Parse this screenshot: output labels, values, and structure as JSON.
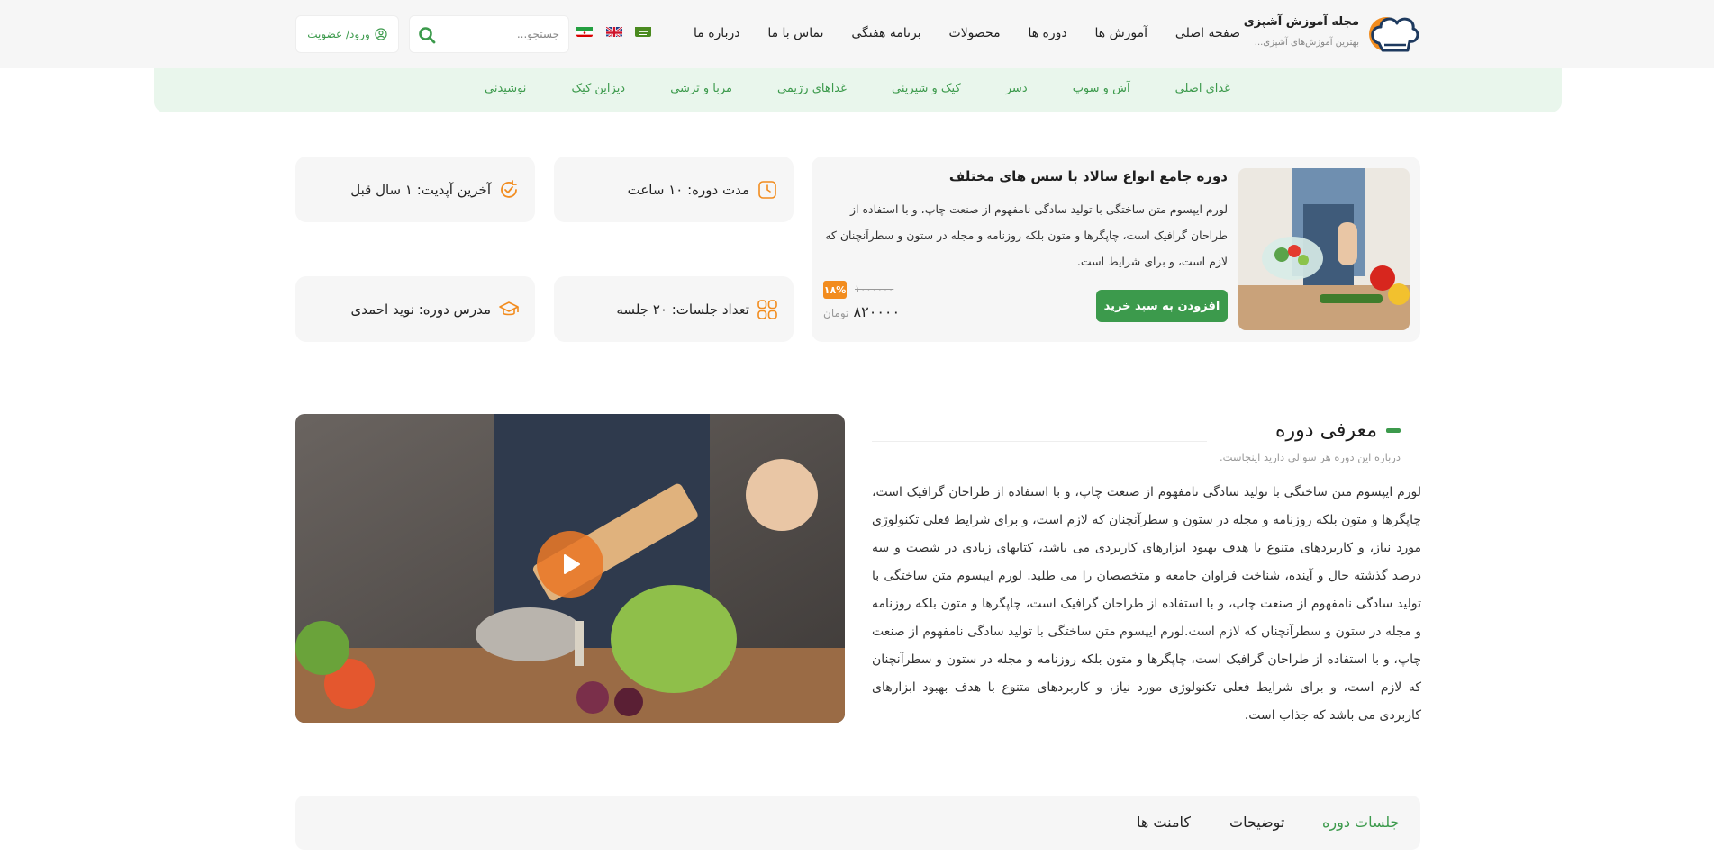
{
  "brand": {
    "title": "مجله آموزش آشپزی",
    "subtitle": "بهترین آموزش‌های آشپزی..."
  },
  "nav": [
    "صفحه اصلی",
    "آموزش ها",
    "دوره ها",
    "محصولات",
    "برنامه هفتگی",
    "تماس با ما",
    "درباره ما"
  ],
  "flags": [
    "iran-flag",
    "uk-flag",
    "saudi-flag"
  ],
  "search": {
    "placeholder": "جستجو..."
  },
  "login": {
    "label": "ورود/ عضویت"
  },
  "categories": [
    "غذای اصلی",
    "آش و سوپ",
    "دسر",
    "کیک و شیرینی",
    "غذاهای رژیمی",
    "مربا و ترشی",
    "دیزاین کیک",
    "نوشیدنی"
  ],
  "course": {
    "title": "دوره جامع انواع سالاد با سس های مختلف",
    "description": "لورم ایپسوم متن ساختگی با تولید سادگی نامفهوم از صنعت چاپ، و با استفاده از طراحان گرافیک است، چاپگرها و متون بلکه روزنامه و مجله در ستون و سطرآنچنان که لازم است، و برای شرایط است.",
    "cart_label": "افزودن به سبد خرید",
    "discount": "۱۸%",
    "old_price": "۱۰۰۰۰۰۰",
    "price": "۸۲۰۰۰۰",
    "currency": "تومان"
  },
  "info": {
    "duration": "مدت دوره: ۱۰ ساعت",
    "last_update": "آخرین آپدیت: ۱ سال قبل",
    "sessions": "تعداد جلسات: ۲۰ جلسه",
    "teacher": "مدرس دوره: نوید احمدی"
  },
  "intro": {
    "title": "معرفی دوره",
    "subtitle": "درباره این دوره هر سوالی دارید اینجاست.",
    "text": "لورم ایپسوم متن ساختگی با تولید سادگی نامفهوم از صنعت چاپ، و با استفاده از طراحان گرافیک است، چاپگرها و متون بلکه روزنامه و مجله در ستون و سطرآنچنان که لازم است، و برای شرایط فعلی تکنولوژی مورد نیاز، و کاربردهای متنوع با هدف بهبود ابزارهای کاربردی می باشد، کتابهای زیادی در شصت و سه درصد گذشته حال و آینده، شناخت فراوان جامعه و متخصصان را می طلبد. لورم ایپسوم متن ساختگی با تولید سادگی نامفهوم از صنعت چاپ، و با استفاده از طراحان گرافیک است، چاپگرها و متون بلکه روزنامه و مجله در ستون و سطرآنچنان که لازم است.لورم ایپسوم متن ساختگی با تولید سادگی نامفهوم از صنعت چاپ، و با استفاده از طراحان گرافیک است، چاپگرها و متون بلکه روزنامه و مجله در ستون و سطرآنچنان که لازم است، و برای شرایط فعلی تکنولوژی مورد نیاز، و کاربردهای متنوع با هدف بهبود ابزارهای کاربردی می باشد که جذاب است."
  },
  "tabs": [
    "جلسات دوره",
    "توضیحات",
    "کامنت ها"
  ],
  "colors": {
    "accent": "#3c9a4c",
    "orange": "#f28c1e",
    "panel": "#f6f6f6",
    "category_bg": "#e9f6ec"
  }
}
